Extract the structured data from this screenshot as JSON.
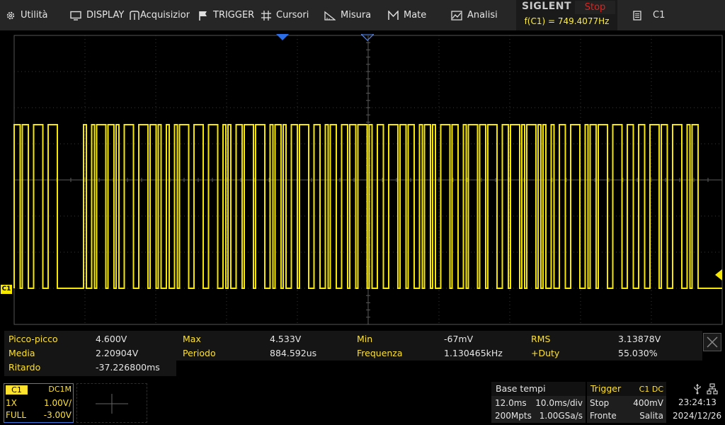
{
  "menu": [
    {
      "id": "utilita",
      "label": "Utilità",
      "icon": "gear-icon"
    },
    {
      "id": "display",
      "label": "DISPLAY",
      "icon": "monitor-icon"
    },
    {
      "id": "acquisizione",
      "label": "Acquisizione",
      "icon": "acquire-icon"
    },
    {
      "id": "trigger",
      "label": "TRIGGER",
      "icon": "flag-icon"
    },
    {
      "id": "cursori",
      "label": "Cursori",
      "icon": "crosshair-icon"
    },
    {
      "id": "misura",
      "label": "Misura",
      "icon": "ruler-icon"
    },
    {
      "id": "mate",
      "label": "Mate",
      "icon": "math-icon"
    },
    {
      "id": "analisi",
      "label": "Analisi",
      "icon": "analysis-icon"
    }
  ],
  "brand": {
    "logo": "SIGLENT",
    "run_state": "Stop",
    "freq_readout": "f(C1) = 749.4077Hz"
  },
  "channel_menu": {
    "label": "C1",
    "icon": "channel-doc-icon"
  },
  "screen": {
    "channel_tag": "C1",
    "trace_color": "#f6e800",
    "grid_color": "#3a3a3a",
    "background": "#000000"
  },
  "measurements": [
    [
      {
        "label": "Picco-picco",
        "value": "4.600V"
      },
      {
        "label": "Max",
        "value": "4.533V"
      },
      {
        "label": "Min",
        "value": "-67mV"
      },
      {
        "label": "RMS",
        "value": "3.13878V"
      }
    ],
    [
      {
        "label": "Media",
        "value": "2.20904V"
      },
      {
        "label": "Periodo",
        "value": "884.592us"
      },
      {
        "label": "Frequenza",
        "value": "1.130465kHz"
      },
      {
        "label": "+Duty",
        "value": "55.030%"
      }
    ],
    [
      {
        "label": "Ritardo",
        "value": "-37.226800ms"
      }
    ]
  ],
  "channel": {
    "name": "C1",
    "coupling": "DC1M",
    "probe": "1X",
    "scale": "1.00V/",
    "bandwidth": "FULL",
    "offset": "-3.00V"
  },
  "timebase": {
    "title": "Base tempi",
    "delay": "12.0ms",
    "scale": "10.0ms/div",
    "memory": "200Mpts",
    "sample_rate": "1.00GSa/s"
  },
  "trigger": {
    "title": "Trigger",
    "source": "C1 DC",
    "mode": "Stop",
    "level": "400mV",
    "type": "Fronte",
    "slope": "Salita"
  },
  "status": {
    "time": "23:24:13",
    "date": "2024/12/26",
    "usb_icon": "usb-icon",
    "network_icon": "network-icon"
  },
  "colors": {
    "accent_yellow": "#ffe22e",
    "stop_red": "#e0221e",
    "channel_blue": "#3c7ae0"
  }
}
